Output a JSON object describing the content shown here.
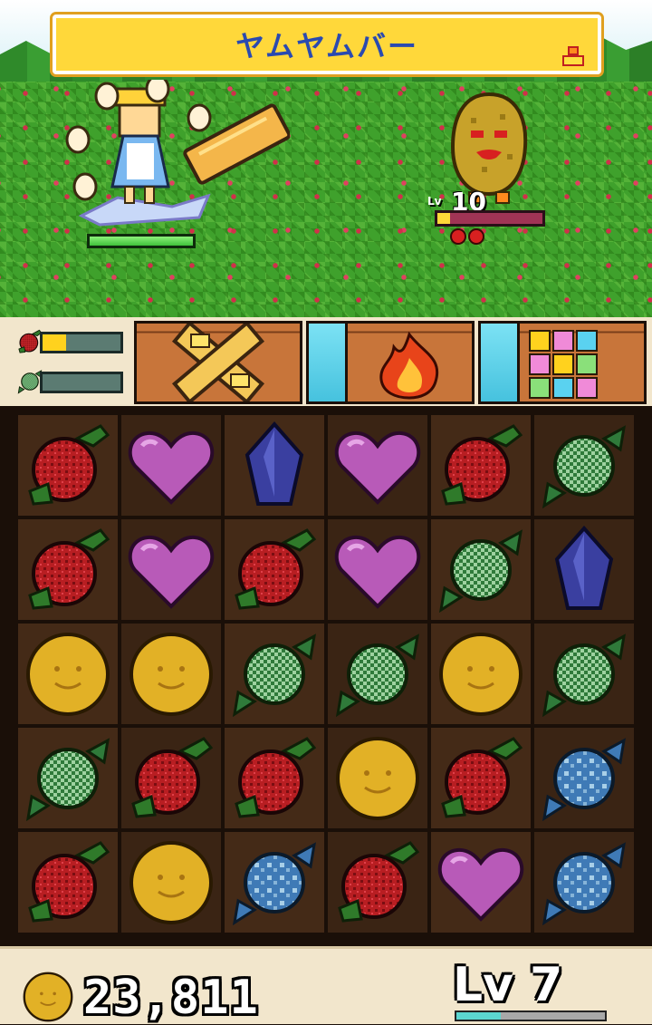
{
  "battle": {
    "skill_banner": "ヤムヤムバー",
    "hero_hp": 1.0,
    "enemy": {
      "level_label": "Lv",
      "level": "10",
      "hp": 0.12
    }
  },
  "gauges": [
    {
      "name": "red",
      "fill": 0.3
    },
    {
      "name": "green",
      "fill": 0.0
    }
  ],
  "skills": [
    {
      "name": "crossed-bars-skill",
      "charge": 0.0
    },
    {
      "name": "flame-skill",
      "charge": 1.0
    },
    {
      "name": "candy-grid-skill",
      "charge": 1.0
    }
  ],
  "board": [
    [
      "berry",
      "heart",
      "crystal",
      "heart",
      "berry",
      "candy-green"
    ],
    [
      "berry",
      "heart",
      "berry",
      "heart",
      "candy-green",
      "crystal"
    ],
    [
      "coin",
      "coin",
      "candy-green",
      "candy-green",
      "coin",
      "candy-green"
    ],
    [
      "candy-green",
      "berry",
      "berry",
      "coin",
      "berry",
      "candy-blue"
    ],
    [
      "berry",
      "coin",
      "candy-blue",
      "berry",
      "heart",
      "candy-blue"
    ]
  ],
  "footer": {
    "coins": "23,811",
    "level": "Lv 7",
    "exp": 0.3
  },
  "colors": {
    "berry": "#b81e22",
    "heart": "#b85ab8",
    "crystal": "#3a3fa0",
    "coin": "#e2b126",
    "candy_green": "#2f7a3a",
    "candy_blue": "#3f7ab6"
  }
}
